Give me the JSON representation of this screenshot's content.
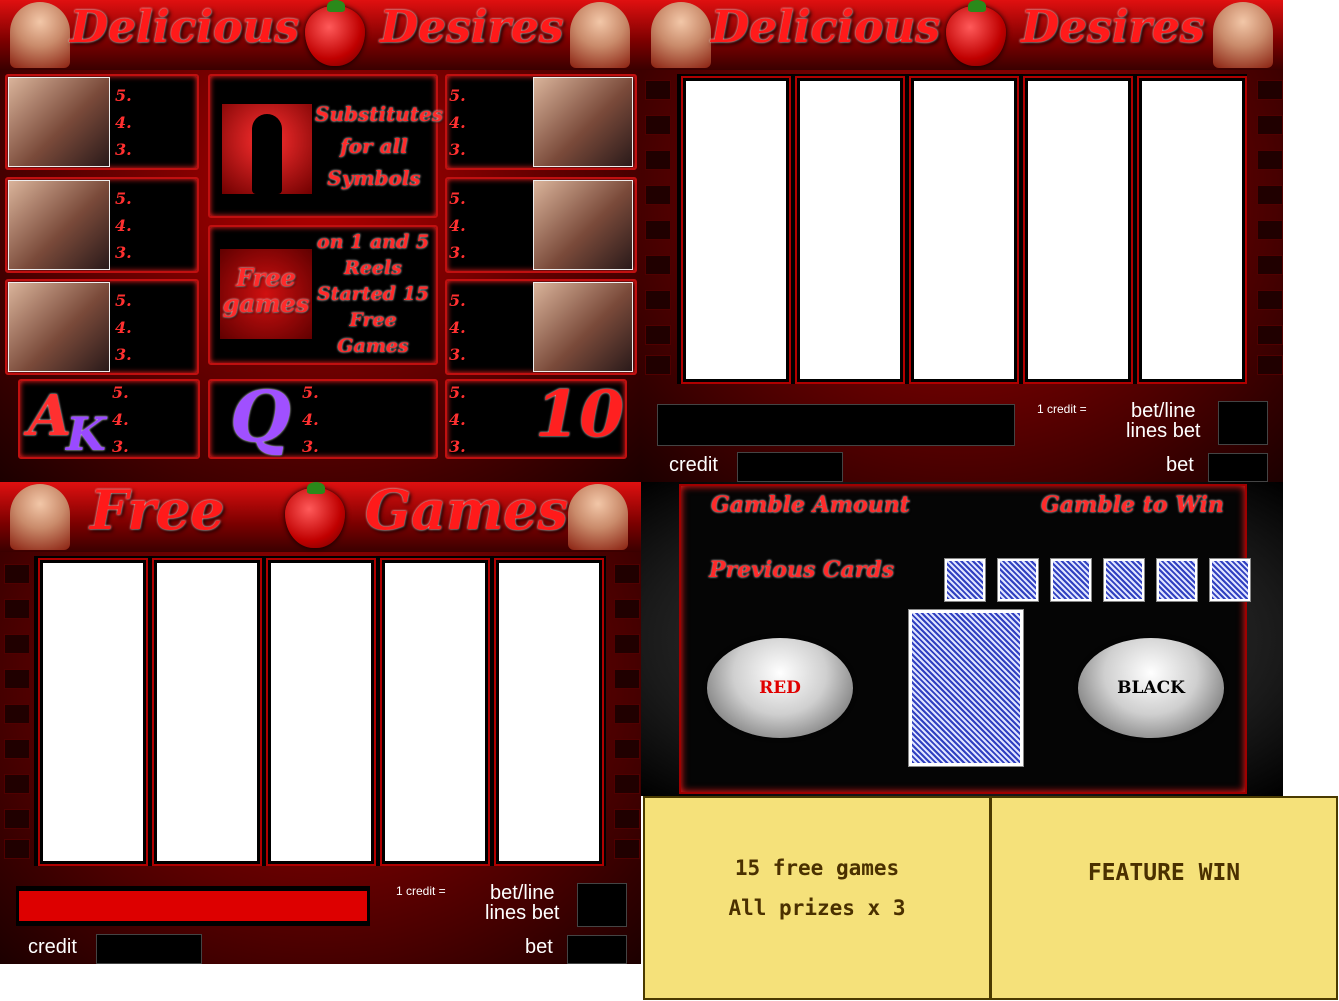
{
  "colors": {
    "accent_red": "#c01010",
    "panel_yellow": "#f5e17a",
    "reel_white": "#ffffff"
  },
  "paytable": {
    "title_left": "Delicious",
    "title_right": "Desires",
    "pays_labels": [
      "5.",
      "4.",
      "3."
    ],
    "wild_text": "Substitutes for all Symbols",
    "scatter_text": "Free games",
    "scatter_desc": "on 1 and 5 Reels Started 15 Free Games",
    "letters": [
      "A",
      "K",
      "Q",
      "10"
    ]
  },
  "main_game": {
    "title_left": "Delicious",
    "title_right": "Desires",
    "credit_equals": "1 credit =",
    "bet_line_label": "bet/line",
    "lines_bet_label": "lines bet",
    "credit_label": "credit",
    "bet_label": "bet"
  },
  "free_games": {
    "title_left": "Free",
    "title_right": "Games",
    "credit_equals": "1 credit =",
    "bet_line_label": "bet/line",
    "lines_bet_label": "lines bet",
    "credit_label": "credit",
    "bet_label": "bet"
  },
  "gamble": {
    "gamble_amount": "Gamble Amount",
    "gamble_to_win": "Gamble to Win",
    "previous_cards": "Previous Cards",
    "red_button": "RED",
    "black_button": "BLACK"
  },
  "notices": {
    "free_line1": "15 free games",
    "free_line2": "All prizes x 3",
    "feature_win": "FEATURE WIN"
  }
}
